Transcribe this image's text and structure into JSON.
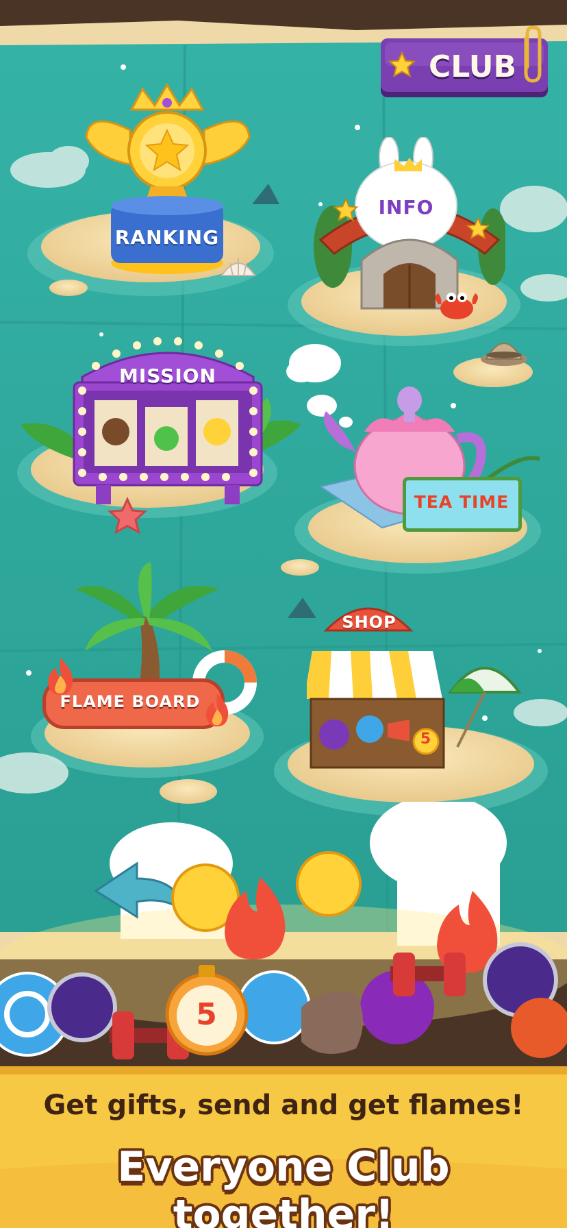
{
  "club_button": {
    "label": "CLUB"
  },
  "islands": {
    "ranking": "RANKING",
    "info": "INFO",
    "mission": "MISSION",
    "tea_time": "TEA TIME",
    "flame_board": "FLAME BOARD",
    "shop": "SHOP"
  },
  "items": {
    "timer_value": "5",
    "shop_timer_value": "5"
  },
  "caption": {
    "line1": "Get gifts, send and get flames!",
    "line2": "Everyone Club together!"
  },
  "colors": {
    "sea": "#2ea59b",
    "sand": "#f0d9a2",
    "club_purple": "#7a3fb0",
    "caption_band": "#f7c844",
    "frame_brown": "#4a3426"
  }
}
